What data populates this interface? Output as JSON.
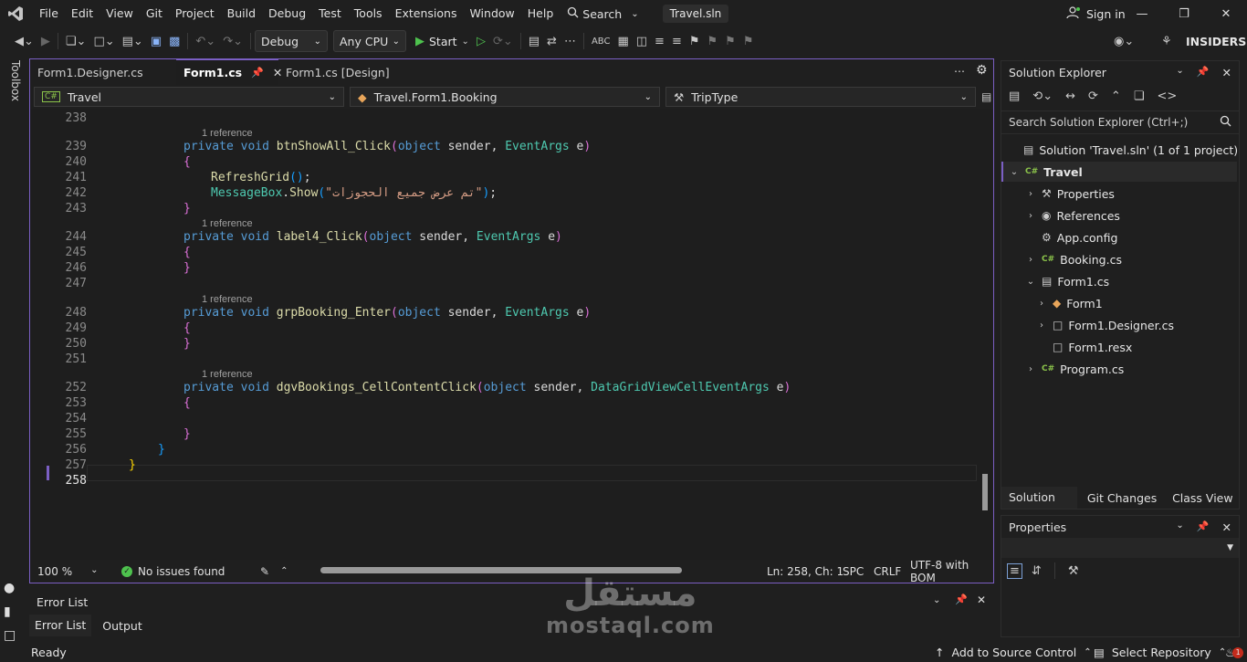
{
  "titlebar": {
    "menu": [
      "File",
      "Edit",
      "View",
      "Git",
      "Project",
      "Build",
      "Debug",
      "Test",
      "Tools",
      "Extensions",
      "Window",
      "Help"
    ],
    "search_label": "Search",
    "solution_badge": "Travel.sln",
    "signin": "Sign in"
  },
  "toolbar": {
    "config": "Debug",
    "platform": "Any CPU",
    "start": "Start",
    "insiders": "INSIDERS"
  },
  "toolbox_label": "Toolbox",
  "editor": {
    "tabs": [
      "Form1.Designer.cs",
      "Form1.cs",
      "Form1.cs [Design]"
    ],
    "nav": {
      "project": "Travel",
      "class": "Travel.Form1.Booking",
      "member": "TripType"
    },
    "ref_text": "1 reference",
    "lines": [
      {
        "n": "238"
      },
      {
        "n": "239",
        "parts": [
          [
            "kw",
            "private void "
          ],
          [
            "fn",
            "btnShowAll_Click"
          ],
          [
            "br1",
            "("
          ],
          [
            "kw",
            "object "
          ],
          [
            "pu",
            "sender, "
          ],
          [
            "ty",
            "EventArgs "
          ],
          [
            "pu",
            "e"
          ],
          [
            "br1",
            ")"
          ]
        ]
      },
      {
        "n": "240",
        "parts": [
          [
            "br1",
            "{"
          ]
        ]
      },
      {
        "n": "241",
        "parts": [
          [
            "fn",
            "RefreshGrid"
          ],
          [
            "br2",
            "()"
          ],
          [
            "pu",
            ";"
          ]
        ]
      },
      {
        "n": "242",
        "parts": [
          [
            "ty",
            "MessageBox"
          ],
          [
            "pu",
            "."
          ],
          [
            "fn",
            "Show"
          ],
          [
            "br2",
            "("
          ],
          [
            "st",
            "\"تم عرض جميع الحجوزات\""
          ],
          [
            "br2",
            ")"
          ],
          [
            "pu",
            ";"
          ]
        ]
      },
      {
        "n": "243",
        "parts": [
          [
            "br1",
            "}"
          ]
        ]
      },
      {
        "n": "244",
        "parts": [
          [
            "kw",
            "private void "
          ],
          [
            "fn",
            "label4_Click"
          ],
          [
            "br1",
            "("
          ],
          [
            "kw",
            "object "
          ],
          [
            "pu",
            "sender, "
          ],
          [
            "ty",
            "EventArgs "
          ],
          [
            "pu",
            "e"
          ],
          [
            "br1",
            ")"
          ]
        ]
      },
      {
        "n": "245",
        "parts": [
          [
            "br1",
            "{"
          ]
        ]
      },
      {
        "n": "246",
        "parts": [
          [
            "br1",
            "}"
          ]
        ]
      },
      {
        "n": "247"
      },
      {
        "n": "248",
        "parts": [
          [
            "kw",
            "private void "
          ],
          [
            "fn",
            "grpBooking_Enter"
          ],
          [
            "br1",
            "("
          ],
          [
            "kw",
            "object "
          ],
          [
            "pu",
            "sender, "
          ],
          [
            "ty",
            "EventArgs "
          ],
          [
            "pu",
            "e"
          ],
          [
            "br1",
            ")"
          ]
        ]
      },
      {
        "n": "249",
        "parts": [
          [
            "br1",
            "{"
          ]
        ]
      },
      {
        "n": "250",
        "parts": [
          [
            "br1",
            "}"
          ]
        ]
      },
      {
        "n": "251"
      },
      {
        "n": "252",
        "parts": [
          [
            "kw",
            "private void "
          ],
          [
            "fn",
            "dgvBookings_CellContentClick"
          ],
          [
            "br1",
            "("
          ],
          [
            "kw",
            "object "
          ],
          [
            "pu",
            "sender, "
          ],
          [
            "ty",
            "DataGridViewCellEventArgs "
          ],
          [
            "pu",
            "e"
          ],
          [
            "br1",
            ")"
          ]
        ]
      },
      {
        "n": "253",
        "parts": [
          [
            "br1",
            "{"
          ]
        ]
      },
      {
        "n": "254"
      },
      {
        "n": "255",
        "parts": [
          [
            "br1",
            "}"
          ]
        ]
      },
      {
        "n": "256",
        "parts": [
          [
            "br2",
            "}"
          ]
        ]
      },
      {
        "n": "257",
        "parts": [
          [
            "br3",
            "}"
          ]
        ]
      },
      {
        "n": "258"
      }
    ],
    "status": {
      "zoom": "100 %",
      "issues": "No issues found",
      "position": "Ln: 258, Ch: 1",
      "spc": "SPC",
      "crlf": "CRLF",
      "encoding": "UTF-8 with BOM"
    }
  },
  "errorlist": {
    "title": "Error List",
    "tabs": [
      "Error List",
      "Output"
    ]
  },
  "solution_explorer": {
    "title": "Solution Explorer",
    "search_placeholder": "Search Solution Explorer (Ctrl+;)",
    "items": [
      {
        "label": "Solution 'Travel.sln' (1 of 1 project)",
        "icon": "solution-icon"
      },
      {
        "label": "Travel",
        "icon": "csharp-project-icon"
      },
      {
        "label": "Properties",
        "icon": "wrench-icon"
      },
      {
        "label": "References",
        "icon": "references-icon"
      },
      {
        "label": "App.config",
        "icon": "config-icon"
      },
      {
        "label": "Booking.cs",
        "icon": "csharp-file-icon"
      },
      {
        "label": "Form1.cs",
        "icon": "form-icon"
      },
      {
        "label": "Form1",
        "icon": "class-icon"
      },
      {
        "label": "Form1.Designer.cs",
        "icon": "file-icon"
      },
      {
        "label": "Form1.resx",
        "icon": "file-icon"
      },
      {
        "label": "Program.cs",
        "icon": "csharp-file-icon"
      }
    ],
    "bottom_tabs": [
      "Solution Ex...",
      "Git Changes",
      "Class View"
    ]
  },
  "properties": {
    "title": "Properties"
  },
  "statusbar": {
    "ready": "Ready",
    "source_control": "Add to Source Control",
    "repo": "Select Repository",
    "notif_count": "1"
  },
  "watermark": {
    "arabic": "مستقل",
    "latin": "mostaql.com"
  },
  "colors": {
    "accent": "#7b5fc4",
    "green": "#4ec24e"
  }
}
